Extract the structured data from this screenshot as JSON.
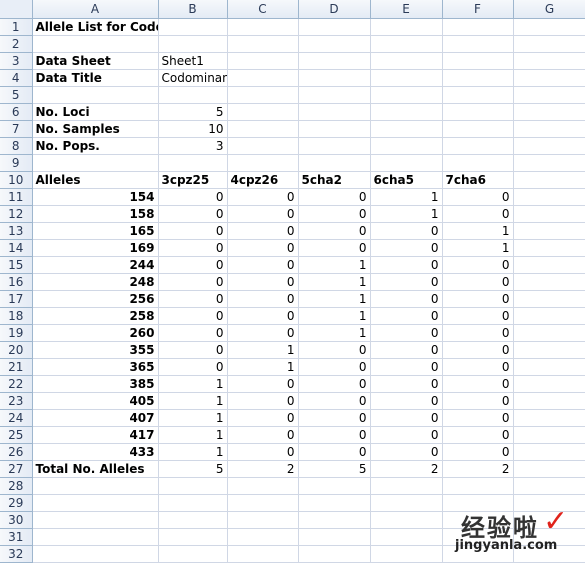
{
  "columns": [
    "A",
    "B",
    "C",
    "D",
    "E",
    "F",
    "G"
  ],
  "title": "Allele List for Codominant Data",
  "data_sheet": {
    "label": "Data Sheet",
    "value": "Sheet1"
  },
  "data_title": {
    "label": "Data Title",
    "value": "Codominant data - fragment size"
  },
  "no_loci": {
    "label": "No. Loci",
    "value": "5"
  },
  "no_samples": {
    "label": "No. Samples",
    "value": "10"
  },
  "no_pops": {
    "label": "No. Pops.",
    "value": "3"
  },
  "alleles_header": {
    "label": "Alleles",
    "loci": [
      "3cpz25",
      "4cpz26",
      "5cha2",
      "6cha5",
      "7cha6"
    ]
  },
  "alleles": [
    {
      "allele": "154",
      "values": [
        "0",
        "0",
        "0",
        "1",
        "0"
      ]
    },
    {
      "allele": "158",
      "values": [
        "0",
        "0",
        "0",
        "1",
        "0"
      ]
    },
    {
      "allele": "165",
      "values": [
        "0",
        "0",
        "0",
        "0",
        "1"
      ]
    },
    {
      "allele": "169",
      "values": [
        "0",
        "0",
        "0",
        "0",
        "1"
      ]
    },
    {
      "allele": "244",
      "values": [
        "0",
        "0",
        "1",
        "0",
        "0"
      ]
    },
    {
      "allele": "248",
      "values": [
        "0",
        "0",
        "1",
        "0",
        "0"
      ]
    },
    {
      "allele": "256",
      "values": [
        "0",
        "0",
        "1",
        "0",
        "0"
      ]
    },
    {
      "allele": "258",
      "values": [
        "0",
        "0",
        "1",
        "0",
        "0"
      ]
    },
    {
      "allele": "260",
      "values": [
        "0",
        "0",
        "1",
        "0",
        "0"
      ]
    },
    {
      "allele": "355",
      "values": [
        "0",
        "1",
        "0",
        "0",
        "0"
      ]
    },
    {
      "allele": "365",
      "values": [
        "0",
        "1",
        "0",
        "0",
        "0"
      ]
    },
    {
      "allele": "385",
      "values": [
        "1",
        "0",
        "0",
        "0",
        "0"
      ]
    },
    {
      "allele": "405",
      "values": [
        "1",
        "0",
        "0",
        "0",
        "0"
      ]
    },
    {
      "allele": "407",
      "values": [
        "1",
        "0",
        "0",
        "0",
        "0"
      ]
    },
    {
      "allele": "417",
      "values": [
        "1",
        "0",
        "0",
        "0",
        "0"
      ]
    },
    {
      "allele": "433",
      "values": [
        "1",
        "0",
        "0",
        "0",
        "0"
      ]
    }
  ],
  "totals": {
    "label": "Total No. Alleles",
    "values": [
      "5",
      "2",
      "5",
      "2",
      "2"
    ]
  },
  "watermark": {
    "top": "经验啦",
    "check": "✓",
    "bottom": "jingyanla.com"
  }
}
